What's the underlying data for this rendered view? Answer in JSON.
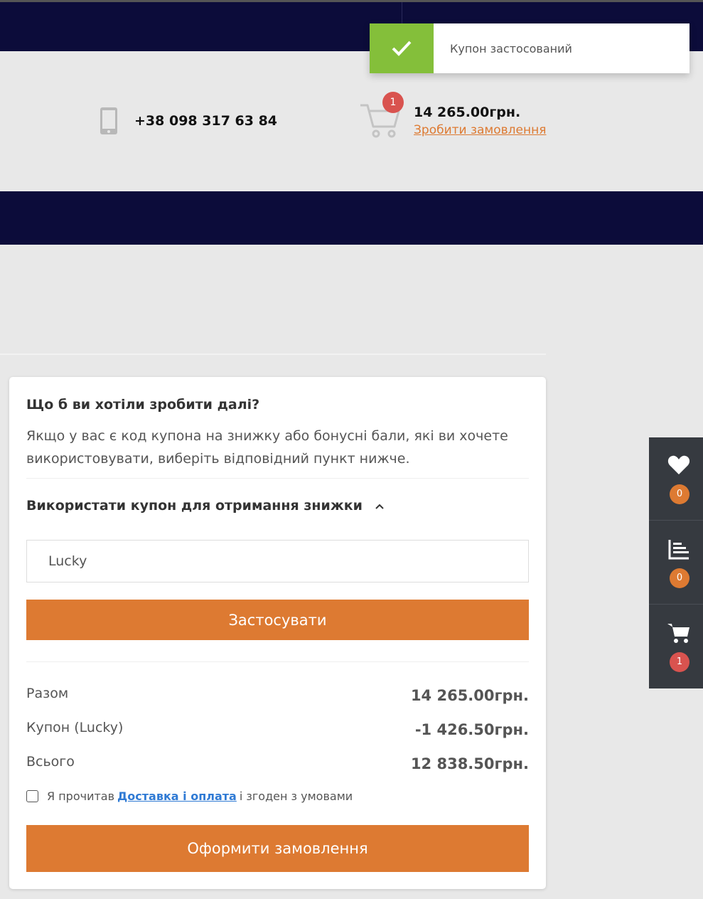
{
  "toast": {
    "message": "Купон застосований"
  },
  "header": {
    "phone": "+38 098 317 63 84",
    "cart_badge": "1",
    "cart_total": "14 265.00грн.",
    "checkout_link": "Зробити замовлення"
  },
  "card": {
    "title": "Що б ви хотіли зробити далі?",
    "description": "Якщо у вас є код купона на знижку або бонусні бали, які ви хочете використовувати, виберіть відповідний пункт нижче.",
    "coupon_toggle": "Використати купон для отримання знижки",
    "coupon_value": "Lucky",
    "apply_label": "Застосувати",
    "totals": [
      {
        "label": "Разом",
        "value": "14 265.00грн."
      },
      {
        "label": "Купон (Lucky)",
        "value": "-1 426.50грн."
      },
      {
        "label": "Всього",
        "value": "12 838.50грн."
      }
    ],
    "agree_prefix": "Я прочитав",
    "agree_link": "Доставка і оплата",
    "agree_suffix": "і згоден з умовами",
    "checkout_label": "Оформити замовлення"
  },
  "side_panel": {
    "wishlist_count": "0",
    "compare_count": "0",
    "cart_count": "1"
  },
  "colors": {
    "accent": "#dd7a32",
    "navy": "#0c0c3a",
    "success": "#84bf3a",
    "badge_red": "#d9534f"
  }
}
